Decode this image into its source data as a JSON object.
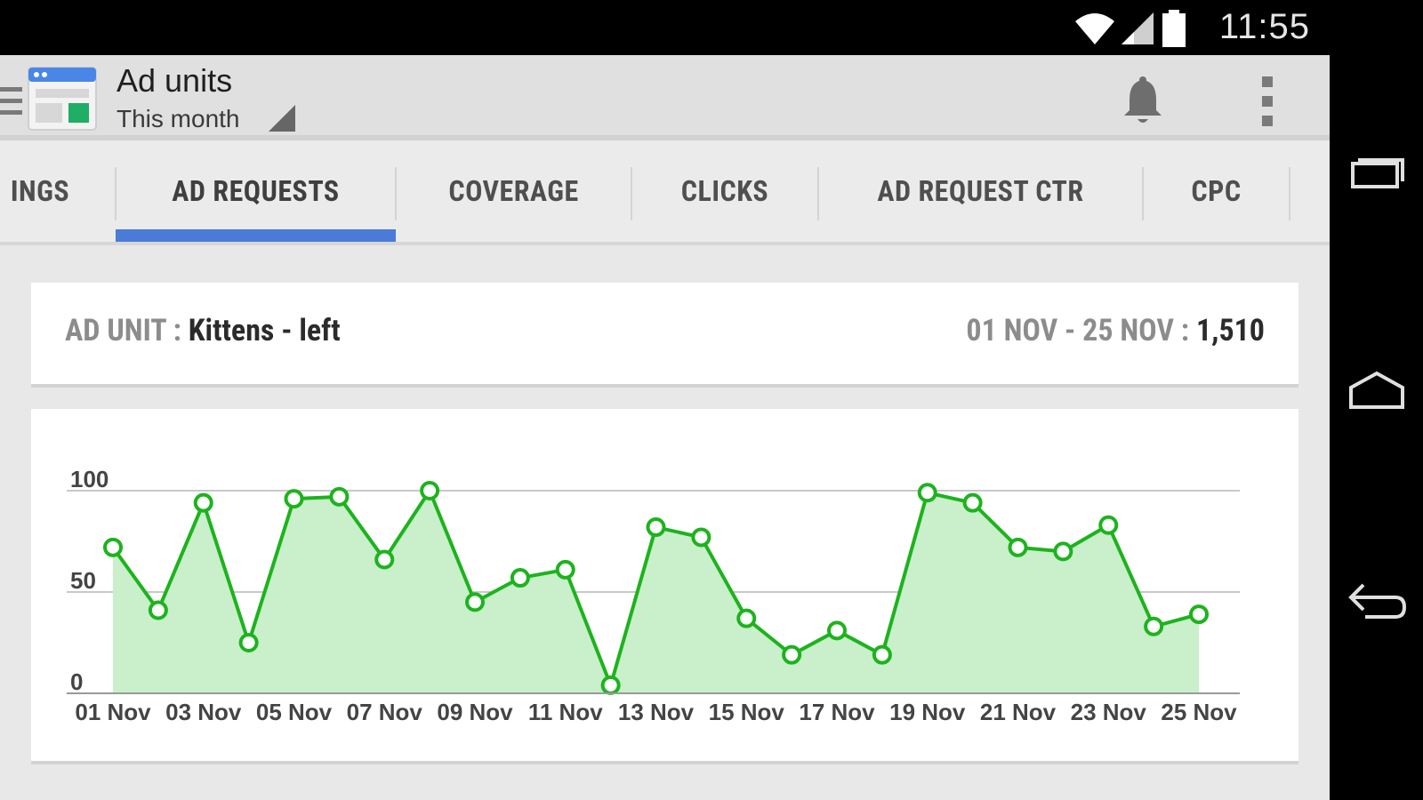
{
  "status_bar": {
    "time": "11:55",
    "icons": [
      "wifi-icon",
      "signal-icon",
      "battery-icon"
    ]
  },
  "nav_bar": {
    "buttons": [
      "recents-icon",
      "home-icon",
      "back-icon"
    ]
  },
  "action_bar": {
    "title": "Ad units",
    "subtitle": "This month",
    "icons": [
      "menu-icon",
      "adsense-app-icon",
      "dropdown-triangle-icon",
      "notification-bell-icon",
      "overflow-menu-icon"
    ]
  },
  "tabs": [
    {
      "label": "INGS"
    },
    {
      "label": "AD REQUESTS",
      "selected": true
    },
    {
      "label": "COVERAGE"
    },
    {
      "label": "CLICKS"
    },
    {
      "label": "AD REQUEST CTR"
    },
    {
      "label": "CPC"
    }
  ],
  "summary": {
    "ad_unit_label": "AD UNIT : ",
    "ad_unit_name": "Kittens - left",
    "range_label": "01 NOV - 25 NOV : ",
    "total": "1,510"
  },
  "colors": {
    "accent": "#4a7bd8",
    "line": "#1db31d",
    "fill": "#c9efcb"
  },
  "chart_data": {
    "type": "area",
    "x": [
      "01 Nov",
      "02 Nov",
      "03 Nov",
      "04 Nov",
      "05 Nov",
      "06 Nov",
      "07 Nov",
      "08 Nov",
      "09 Nov",
      "10 Nov",
      "11 Nov",
      "12 Nov",
      "13 Nov",
      "14 Nov",
      "15 Nov",
      "16 Nov",
      "17 Nov",
      "18 Nov",
      "19 Nov",
      "20 Nov",
      "21 Nov",
      "22 Nov",
      "23 Nov",
      "24 Nov",
      "25 Nov"
    ],
    "x_tick_labels": [
      "01 Nov",
      "03 Nov",
      "05 Nov",
      "07 Nov",
      "09 Nov",
      "11 Nov",
      "13 Nov",
      "15 Nov",
      "17 Nov",
      "19 Nov",
      "21 Nov",
      "23 Nov",
      "25 Nov"
    ],
    "series": [
      {
        "values": [
          72,
          41,
          94,
          25,
          96,
          97,
          66,
          100,
          45,
          57,
          61,
          4,
          82,
          77,
          37,
          19,
          31,
          19,
          99,
          94,
          72,
          70,
          83,
          33,
          39
        ]
      }
    ],
    "y_ticks": [
      0,
      50,
      100
    ],
    "ylim": [
      0,
      100
    ],
    "grid": true,
    "markers": "open-circle"
  }
}
